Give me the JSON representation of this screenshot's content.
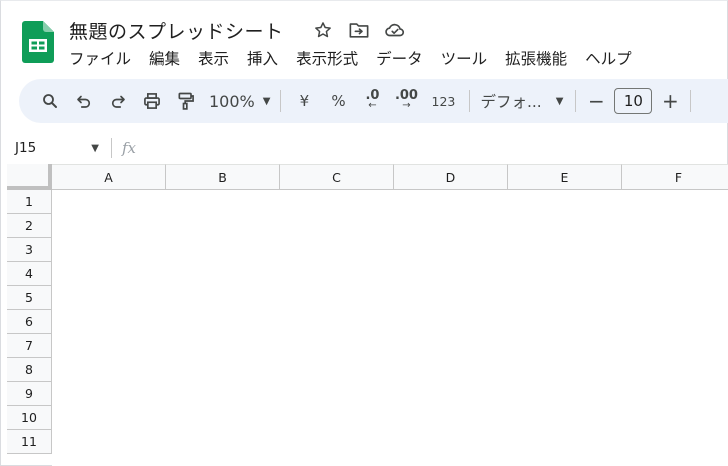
{
  "document": {
    "title": "無題のスプレッドシート",
    "icons": [
      "star-icon",
      "move-to-folder-icon",
      "cloud-status-icon"
    ]
  },
  "menu": [
    "ファイル",
    "編集",
    "表示",
    "挿入",
    "表示形式",
    "データ",
    "ツール",
    "拡張機能",
    "ヘルプ"
  ],
  "toolbar": {
    "zoom": "100%",
    "currency": "¥",
    "percent": "%",
    "decrease_decimal": ".0",
    "increase_decimal": ".00",
    "number_format": "123",
    "font": "デフォ...",
    "font_size": "10",
    "minus": "−",
    "plus": "+"
  },
  "formula_bar": {
    "cell_ref": "J15",
    "fx": "fx",
    "value": ""
  },
  "grid": {
    "columns": [
      "A",
      "B",
      "C",
      "D",
      "E",
      "F"
    ],
    "rows": [
      "1",
      "2",
      "3",
      "4",
      "5",
      "6",
      "7",
      "8",
      "9",
      "10",
      "11"
    ]
  },
  "colors": {
    "brand_green": "#0f9d58",
    "toolbar_bg": "#edf2fa",
    "header_bg": "#f8f9fa"
  }
}
